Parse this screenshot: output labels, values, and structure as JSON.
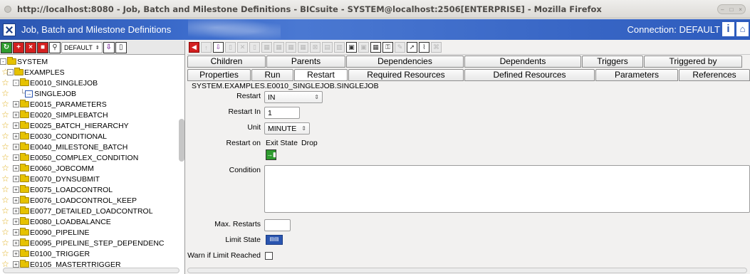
{
  "window": {
    "title": "http://localhost:8080 - Job, Batch and Milestone Definitions - BICsuite - SYSTEM@localhost:2506[ENTERPRISE] - Mozilla Firefox"
  },
  "header": {
    "title": "Job, Batch and Milestone Definitions",
    "connection": "Connection: DEFAULT",
    "info_label": "i",
    "home_label": "⌂"
  },
  "left_toolbar": {
    "selector_value": "DEFAULT"
  },
  "tree": [
    {
      "label": "SYSTEM",
      "level": 0,
      "toggle": "-",
      "type": "folder"
    },
    {
      "label": "EXAMPLES",
      "level": 1,
      "toggle": "-",
      "type": "folder"
    },
    {
      "label": "E0010_SINGLEJOB",
      "level": 2,
      "toggle": "-",
      "type": "folder"
    },
    {
      "label": "SINGLEJOB",
      "level": 3,
      "toggle": "",
      "type": "job"
    },
    {
      "label": "E0015_PARAMETERS",
      "level": 2,
      "toggle": "+",
      "type": "folder"
    },
    {
      "label": "E0020_SIMPLEBATCH",
      "level": 2,
      "toggle": "+",
      "type": "folder"
    },
    {
      "label": "E0025_BATCH_HIERARCHY",
      "level": 2,
      "toggle": "+",
      "type": "folder"
    },
    {
      "label": "E0030_CONDITIONAL",
      "level": 2,
      "toggle": "+",
      "type": "folder"
    },
    {
      "label": "E0040_MILESTONE_BATCH",
      "level": 2,
      "toggle": "+",
      "type": "folder"
    },
    {
      "label": "E0050_COMPLEX_CONDITION",
      "level": 2,
      "toggle": "+",
      "type": "folder"
    },
    {
      "label": "E0060_JOBCOMM",
      "level": 2,
      "toggle": "+",
      "type": "folder"
    },
    {
      "label": "E0070_DYNSUBMIT",
      "level": 2,
      "toggle": "+",
      "type": "folder"
    },
    {
      "label": "E0075_LOADCONTROL",
      "level": 2,
      "toggle": "+",
      "type": "folder"
    },
    {
      "label": "E0076_LOADCONTROL_KEEP",
      "level": 2,
      "toggle": "+",
      "type": "folder"
    },
    {
      "label": "E0077_DETAILED_LOADCONTROL",
      "level": 2,
      "toggle": "+",
      "type": "folder"
    },
    {
      "label": "E0080_LOADBALANCE",
      "level": 2,
      "toggle": "+",
      "type": "folder"
    },
    {
      "label": "E0090_PIPELINE",
      "level": 2,
      "toggle": "+",
      "type": "folder"
    },
    {
      "label": "E0095_PIPELINE_STEP_DEPENDENC",
      "level": 2,
      "toggle": "+",
      "type": "folder"
    },
    {
      "label": "E0100_TRIGGER",
      "level": 2,
      "toggle": "+",
      "type": "folder"
    },
    {
      "label": "E0105_MASTERTRIGGER",
      "level": 2,
      "toggle": "+",
      "type": "folder"
    }
  ],
  "tabs_row1": [
    "Children",
    "Parents",
    "Dependencies",
    "Dependents",
    "Triggers",
    "Triggered by"
  ],
  "tabs_row2": [
    "Properties",
    "Run",
    "Restart",
    "Required Resources",
    "Defined Resources",
    "Parameters",
    "References"
  ],
  "selected_tab": "Restart",
  "path": "SYSTEM.EXAMPLES.E0010_SINGLEJOB.SINGLEJOB",
  "form": {
    "restart_label": "Restart",
    "restart_value": "IN",
    "restart_in_label": "Restart In",
    "restart_in_value": "1",
    "unit_label": "Unit",
    "unit_value": "MINUTE",
    "restart_on_label": "Restart on",
    "exit_state_header": "Exit State",
    "drop_header": "Drop",
    "condition_label": "Condition",
    "condition_value": "",
    "max_restarts_label": "Max. Restarts",
    "max_restarts_value": "",
    "limit_state_label": "Limit State",
    "warn_label": "Warn if Limit Reached"
  }
}
